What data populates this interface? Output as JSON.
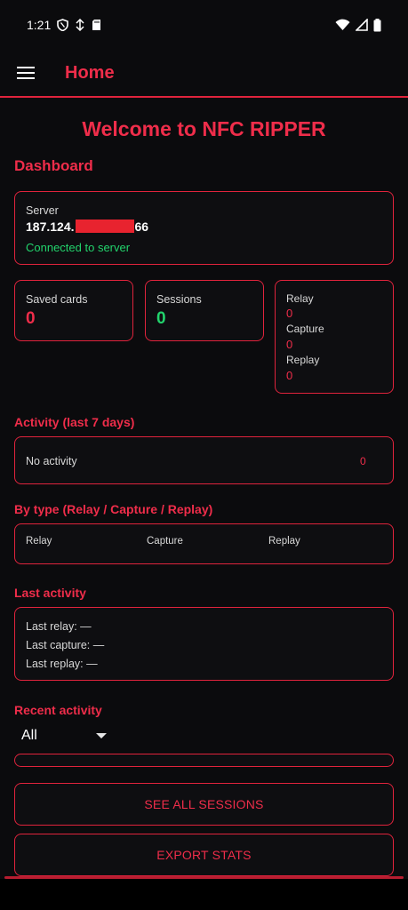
{
  "status": {
    "time": "1:21"
  },
  "app_bar": {
    "title": "Home"
  },
  "welcome": "Welcome to NFC RIPPER",
  "dashboard": {
    "title": "Dashboard",
    "server": {
      "label": "Server",
      "ip_prefix": "187.124.",
      "ip_suffix": "66",
      "status": "Connected to server"
    },
    "saved_cards": {
      "label": "Saved cards",
      "value": "0"
    },
    "sessions": {
      "label": "Sessions",
      "value": "0"
    },
    "types": [
      {
        "label": "Relay",
        "value": "0"
      },
      {
        "label": "Capture",
        "value": "0"
      },
      {
        "label": "Replay",
        "value": "0"
      }
    ]
  },
  "activity": {
    "title": "Activity (last 7 days)",
    "empty_text": "No activity",
    "count": "0"
  },
  "by_type": {
    "title": "By type (Relay / Capture / Replay)",
    "columns": [
      "Relay",
      "Capture",
      "Replay"
    ]
  },
  "last_activity": {
    "title": "Last activity",
    "relay": "Last relay: —",
    "capture": "Last capture: —",
    "replay": "Last replay: —"
  },
  "recent": {
    "title": "Recent activity",
    "filter_value": "All"
  },
  "buttons": {
    "see_all": "SEE ALL SESSIONS",
    "export": "EXPORT STATS"
  },
  "colors": {
    "accent": "#ef2d4a",
    "success": "#22d36c",
    "background": "#0b0b0d"
  }
}
